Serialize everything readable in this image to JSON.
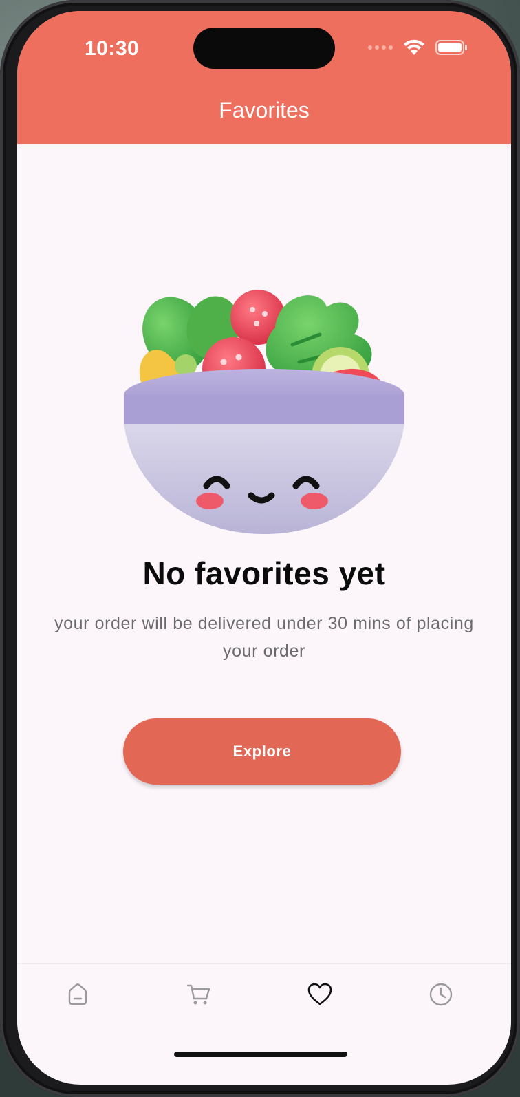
{
  "status_bar": {
    "time": "10:30"
  },
  "header": {
    "title": "Favorites",
    "background_color": "#ef6f5e"
  },
  "empty_state": {
    "illustration": "salad-bowl-illustration",
    "title": "No favorites yet",
    "subtitle": "your order will be delivered under 30 mins of placing your order",
    "button_label": "Explore",
    "button_color": "#e36755"
  },
  "tabbar": {
    "items": [
      {
        "icon": "home-icon",
        "active": false
      },
      {
        "icon": "cart-icon",
        "active": false
      },
      {
        "icon": "heart-icon",
        "active": true
      },
      {
        "icon": "clock-icon",
        "active": false
      }
    ]
  }
}
